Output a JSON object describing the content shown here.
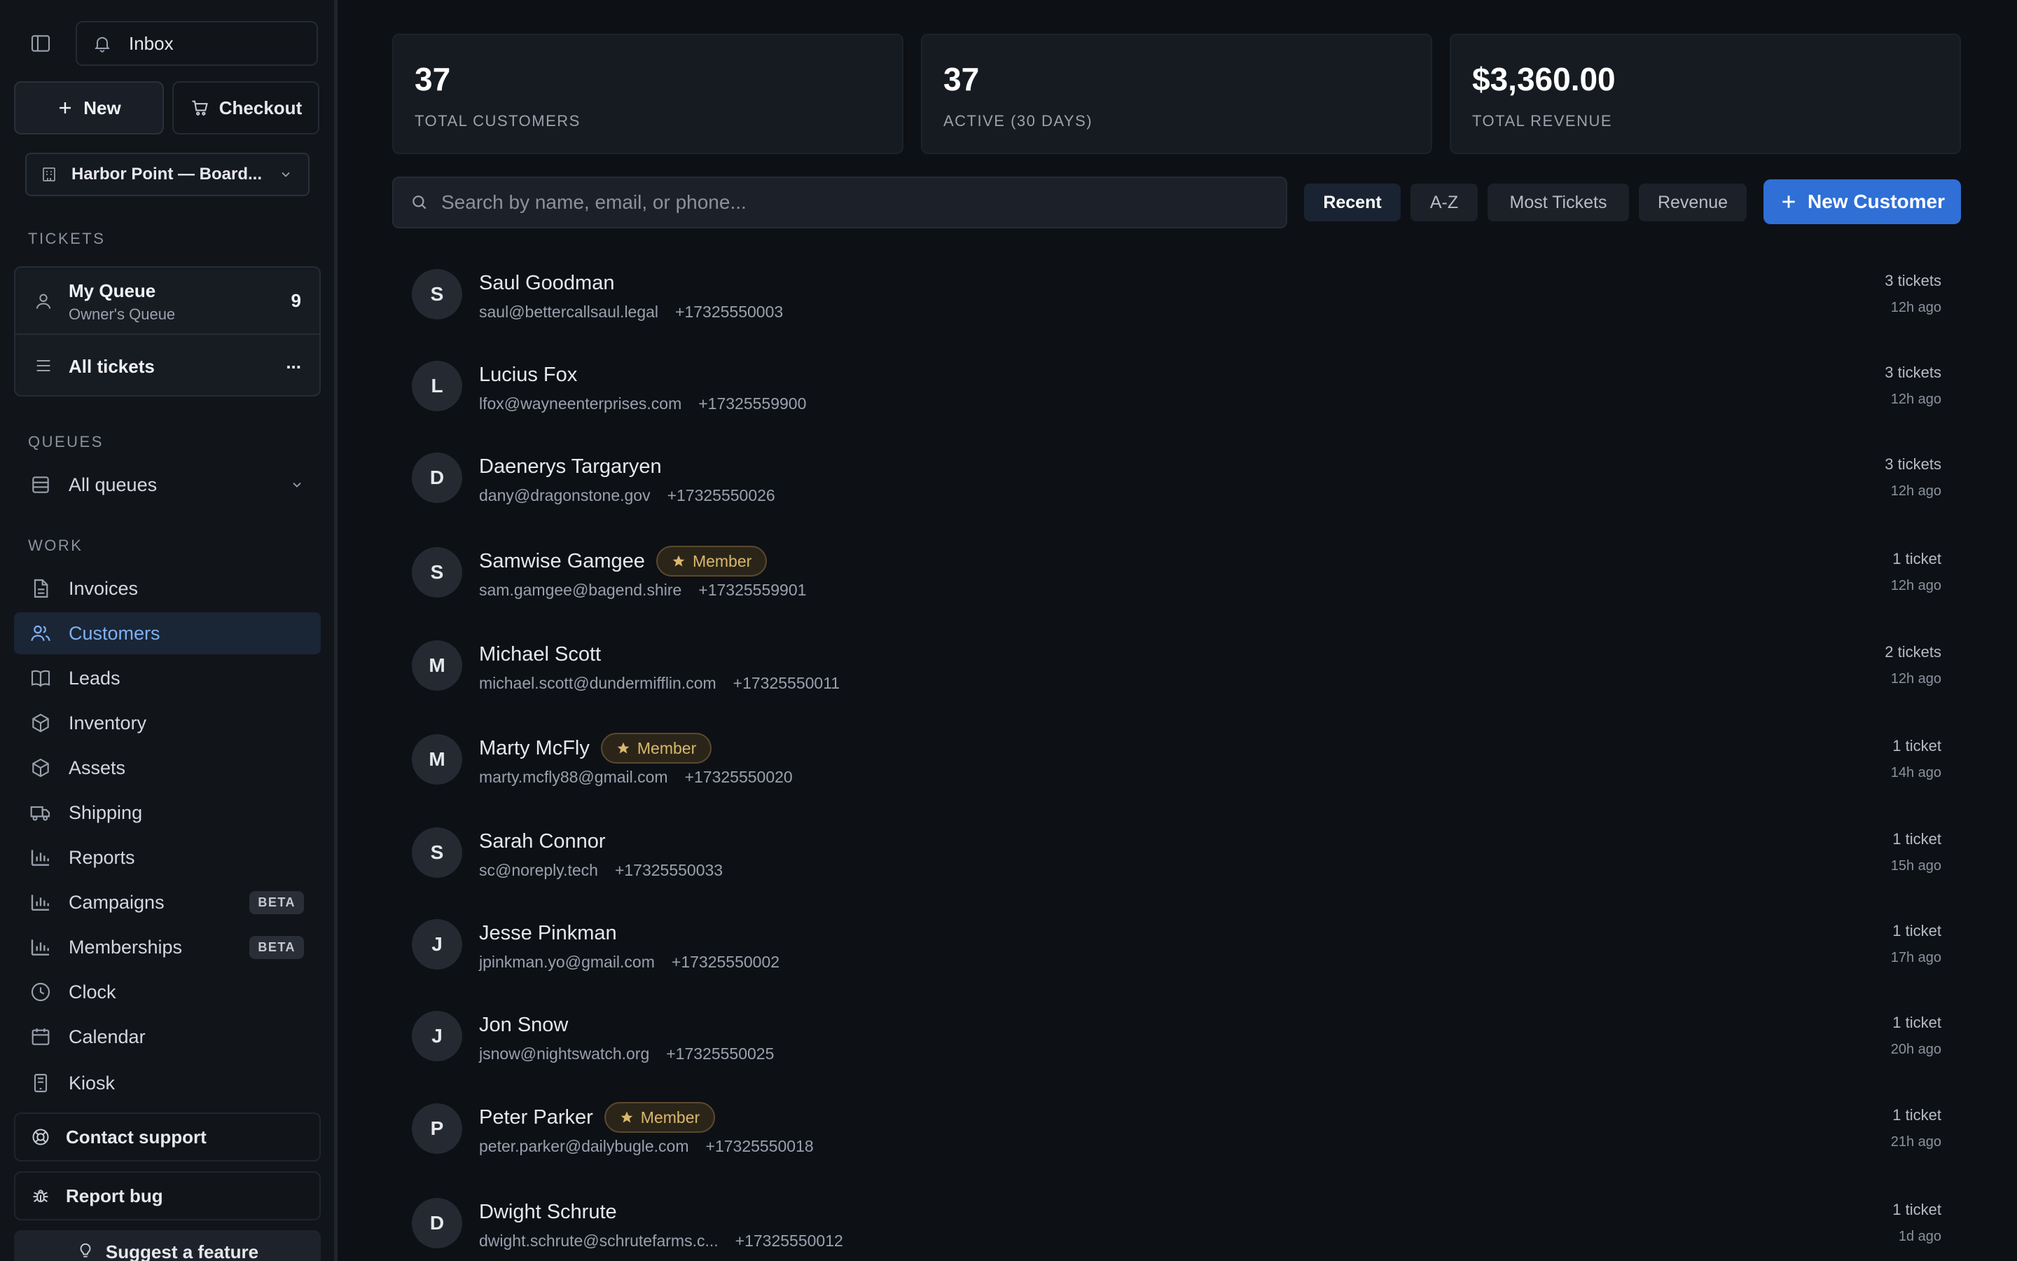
{
  "sidebar": {
    "inbox_label": "Inbox",
    "new_label": "New",
    "checkout_label": "Checkout",
    "location": "Harbor Point — Board...",
    "tickets_title": "TICKETS",
    "my_queue": {
      "title": "My Queue",
      "subtitle": "Owner's Queue",
      "count": "9"
    },
    "all_tickets": {
      "label": "All tickets",
      "more": "..."
    },
    "queues_title": "QUEUES",
    "all_queues_label": "All queues",
    "work_title": "WORK",
    "items": [
      {
        "label": "Invoices",
        "icon": "file-icon"
      },
      {
        "label": "Customers",
        "icon": "users-icon"
      },
      {
        "label": "Leads",
        "icon": "book-icon"
      },
      {
        "label": "Inventory",
        "icon": "box-icon"
      },
      {
        "label": "Assets",
        "icon": "box-icon"
      },
      {
        "label": "Shipping",
        "icon": "truck-icon"
      },
      {
        "label": "Reports",
        "icon": "bar-chart-icon"
      },
      {
        "label": "Campaigns",
        "icon": "bar-chart-icon",
        "badge": "BETA"
      },
      {
        "label": "Memberships",
        "icon": "bar-chart-icon",
        "badge": "BETA"
      },
      {
        "label": "Clock",
        "icon": "clock-icon"
      },
      {
        "label": "Calendar",
        "icon": "calendar-icon"
      },
      {
        "label": "Kiosk",
        "icon": "tablet-icon"
      }
    ],
    "contact_support": "Contact support",
    "report_bug": "Report bug",
    "suggest_feature": "Suggest a feature"
  },
  "stats": [
    {
      "value": "37",
      "label": "TOTAL CUSTOMERS"
    },
    {
      "value": "37",
      "label": "ACTIVE (30 DAYS)"
    },
    {
      "value": "$3,360.00",
      "label": "TOTAL REVENUE"
    }
  ],
  "search": {
    "placeholder": "Search by name, email, or phone...",
    "value": ""
  },
  "sort": {
    "options": [
      "Recent",
      "A-Z",
      "Most Tickets",
      "Revenue"
    ],
    "selected": "Recent"
  },
  "new_customer_label": "New Customer",
  "member_label": "Member",
  "customers": [
    {
      "initial": "S",
      "name": "Saul Goodman",
      "email": "saul@bettercallsaul.legal",
      "phone": "+17325550003",
      "tickets": "3 tickets",
      "time": "12h ago",
      "member": false
    },
    {
      "initial": "L",
      "name": "Lucius Fox",
      "email": "lfox@wayneenterprises.com",
      "phone": "+17325559900",
      "tickets": "3 tickets",
      "time": "12h ago",
      "member": false
    },
    {
      "initial": "D",
      "name": "Daenerys Targaryen",
      "email": "dany@dragonstone.gov",
      "phone": "+17325550026",
      "tickets": "3 tickets",
      "time": "12h ago",
      "member": false
    },
    {
      "initial": "S",
      "name": "Samwise Gamgee",
      "email": "sam.gamgee@bagend.shire",
      "phone": "+17325559901",
      "tickets": "1 ticket",
      "time": "12h ago",
      "member": true
    },
    {
      "initial": "M",
      "name": "Michael Scott",
      "email": "michael.scott@dundermifflin.com",
      "phone": "+17325550011",
      "tickets": "2 tickets",
      "time": "12h ago",
      "member": false
    },
    {
      "initial": "M",
      "name": "Marty McFly",
      "email": "marty.mcfly88@gmail.com",
      "phone": "+17325550020",
      "tickets": "1 ticket",
      "time": "14h ago",
      "member": true
    },
    {
      "initial": "S",
      "name": "Sarah Connor",
      "email": "sc@noreply.tech",
      "phone": "+17325550033",
      "tickets": "1 ticket",
      "time": "15h ago",
      "member": false
    },
    {
      "initial": "J",
      "name": "Jesse Pinkman",
      "email": "jpinkman.yo@gmail.com",
      "phone": "+17325550002",
      "tickets": "1 ticket",
      "time": "17h ago",
      "member": false
    },
    {
      "initial": "J",
      "name": "Jon Snow",
      "email": "jsnow@nightswatch.org",
      "phone": "+17325550025",
      "tickets": "1 ticket",
      "time": "20h ago",
      "member": false
    },
    {
      "initial": "P",
      "name": "Peter Parker",
      "email": "peter.parker@dailybugle.com",
      "phone": "+17325550018",
      "tickets": "1 ticket",
      "time": "21h ago",
      "member": true
    },
    {
      "initial": "D",
      "name": "Dwight Schrute",
      "email": "dwight.schrute@schrutefarms.c...",
      "phone": "+17325550012",
      "tickets": "1 ticket",
      "time": "1d ago",
      "member": false
    }
  ],
  "colors": {
    "accent": "#2f6fd6",
    "active_nav_bg": "#1a2536",
    "active_nav_text": "#7fb0f0",
    "member_gold": "#d9b86c"
  }
}
